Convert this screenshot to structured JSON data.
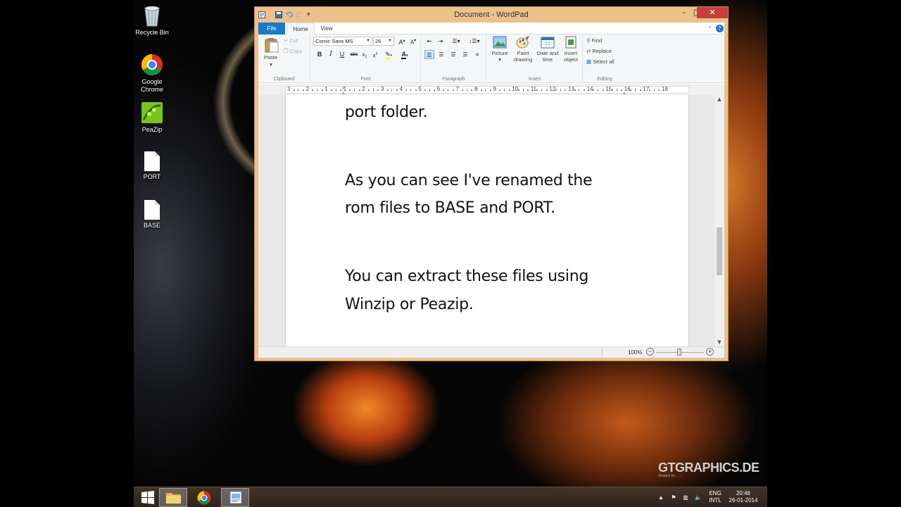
{
  "desktop": {
    "icons": [
      {
        "label": "Recycle Bin",
        "icon": "recycle-bin-icon"
      },
      {
        "label": "Google Chrome",
        "icon": "chrome-icon"
      },
      {
        "label": "PeaZip",
        "icon": "peazip-icon"
      },
      {
        "label": "PORT",
        "icon": "file-icon"
      },
      {
        "label": "BASE",
        "icon": "file-icon"
      }
    ],
    "watermark": "GTGRAPHICS.DE",
    "watermark_sub": "designs by ......"
  },
  "window": {
    "title": "Document - WordPad",
    "controls": {
      "minimize": "–",
      "maximize": "□",
      "close": "✕"
    }
  },
  "ribbon": {
    "tabs": [
      "File",
      "Home",
      "View"
    ],
    "clipboard": {
      "paste": "Paste",
      "cut": "Cut",
      "copy": "Copy",
      "label": "Clipboard"
    },
    "font": {
      "family": "Comic Sans MS",
      "size": "26",
      "label": "Font"
    },
    "paragraph": {
      "label": "Paragraph"
    },
    "insert": {
      "picture": "Picture",
      "paint_drawing": "Paint drawing",
      "date_time": "Date and time",
      "insert_object": "Insert object",
      "label": "Insert"
    },
    "editing": {
      "find": "Find",
      "replace": "Replace",
      "select_all": "Select all",
      "label": "Editing"
    }
  },
  "ruler": {
    "marks": [
      "3",
      "2",
      "1",
      "1",
      "2",
      "3",
      "4",
      "5",
      "6",
      "7",
      "8",
      "9",
      "10",
      "11",
      "12",
      "13",
      "14",
      "15",
      "16",
      "17",
      "18"
    ]
  },
  "document": {
    "lines": [
      "port folder.",
      "As you can see I've renamed the",
      "rom files to BASE and PORT.",
      "You can extract these files using",
      "Winzip or Peazip."
    ]
  },
  "status": {
    "zoom": "100%"
  },
  "taskbar": {
    "language": "ENG",
    "layout": "INTL",
    "time": "20:46",
    "date": "26-01-2014"
  }
}
